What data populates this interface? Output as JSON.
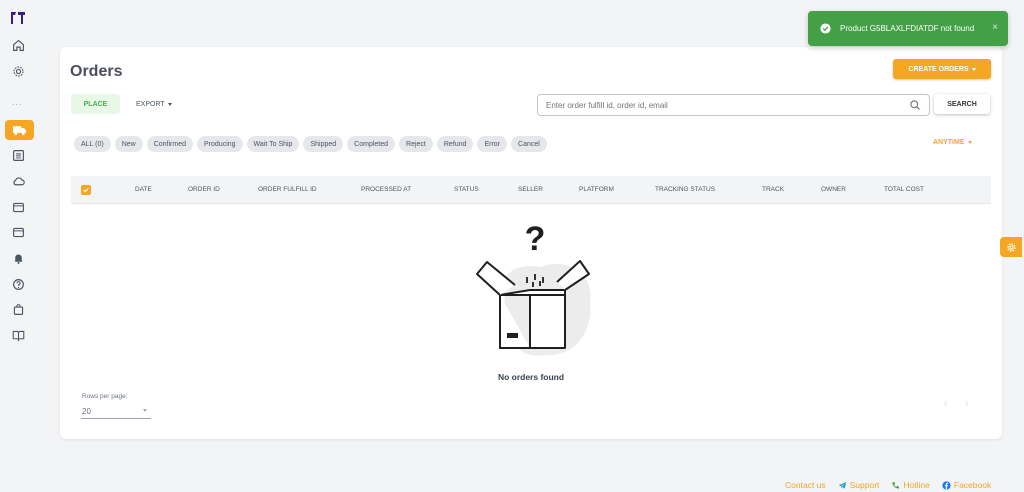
{
  "sidebar": {
    "dots": "..."
  },
  "page": {
    "title": "Orders",
    "create_button": "CREATE ORDERS",
    "place_button": "PLACE",
    "export_button": "EXPORT"
  },
  "search": {
    "placeholder": "Enter order fulfill id, order id, email",
    "button": "SEARCH"
  },
  "filters": [
    "ALL (0)",
    "New",
    "Confirmed",
    "Producing",
    "Wait To Ship",
    "Shipped",
    "Completed",
    "Reject",
    "Refund",
    "Error",
    "Cancel"
  ],
  "time_filter": "ANYTIME",
  "table": {
    "columns": [
      "DATE",
      "ORDER ID",
      "ORDER FULFILL ID",
      "PROCESSED AT",
      "STATUS",
      "SELLER",
      "PLATFORM",
      "TRACKING STATUS",
      "TRACK",
      "OWNER",
      "TOTAL COST"
    ],
    "empty_message": "No orders found"
  },
  "pagination": {
    "rows_label": "Rows per page:",
    "rows_value": "20"
  },
  "toast": {
    "message": "Product G5BLAXLFDIATDF not found",
    "close": "×"
  },
  "footer": {
    "contact": "Contact us",
    "support": "Support",
    "hotline": "Hotline",
    "facebook": "Facebook"
  },
  "colors": {
    "accent": "#f5a623",
    "success": "#43a047"
  }
}
